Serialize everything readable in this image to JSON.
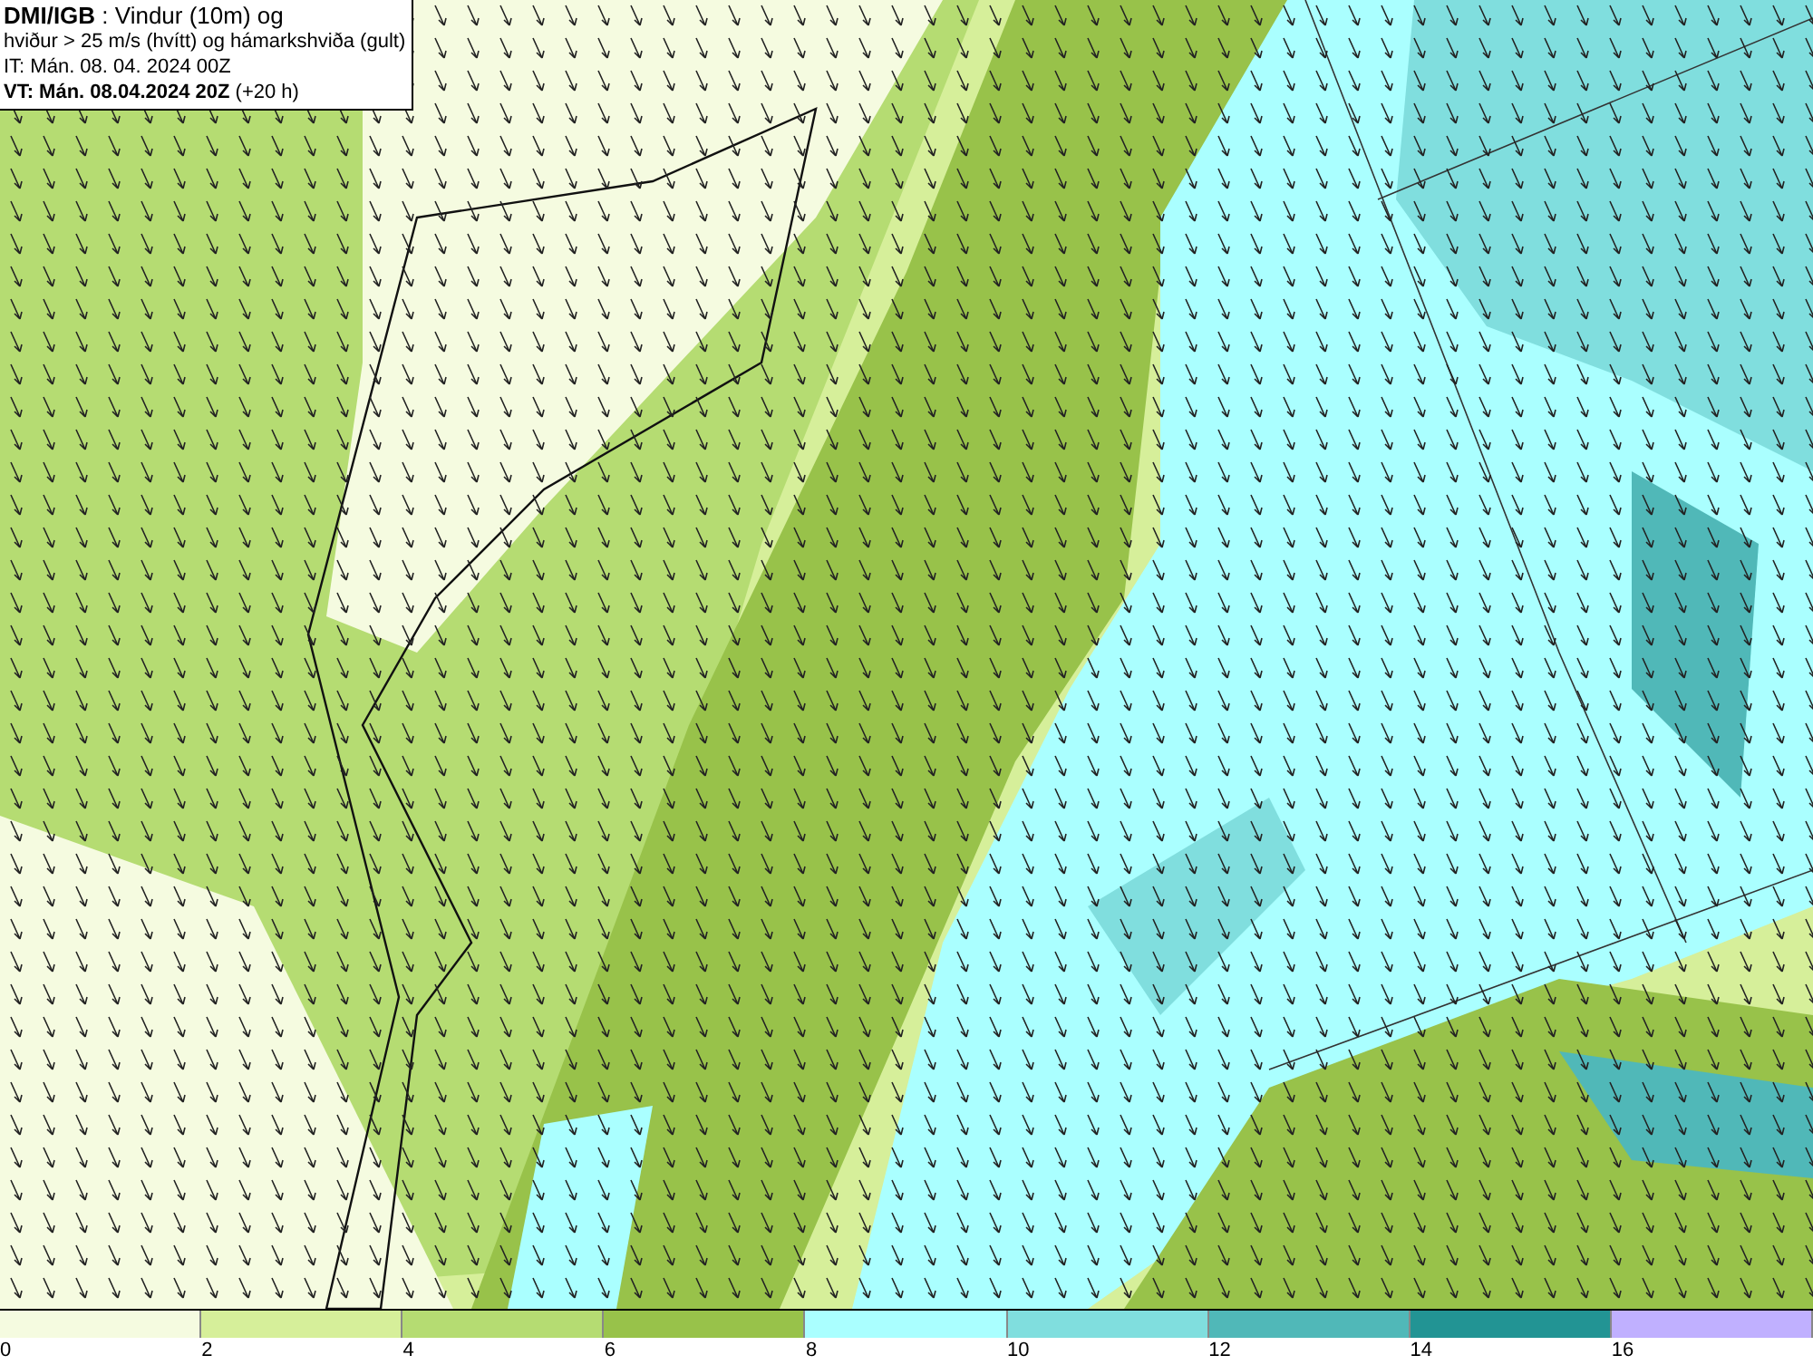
{
  "header": {
    "lines": [
      "**DMI/IGB** : Vindur (10m) og",
      "hviður > 25 m/s (hvítt) og hámarkshviða (gult)",
      "IT: Mán. 08. 04. 2024 00Z",
      "**VT: Mán. 08.04.2024 20Z** (+20 h)"
    ]
  },
  "legend": [
    {
      "label": "0",
      "color": "#f5fbe0"
    },
    {
      "label": "2",
      "color": "#d6ef9a"
    },
    {
      "label": "4",
      "color": "#b5dc72"
    },
    {
      "label": "6",
      "color": "#98c24a"
    },
    {
      "label": "8",
      "color": "#aaffff"
    },
    {
      "label": "10",
      "color": "#80dede"
    },
    {
      "label": "12",
      "color": "#50b8b8"
    },
    {
      "label": "14",
      "color": "#229494"
    },
    {
      "label": "16",
      "color": "#c0b0ff"
    }
  ]
}
